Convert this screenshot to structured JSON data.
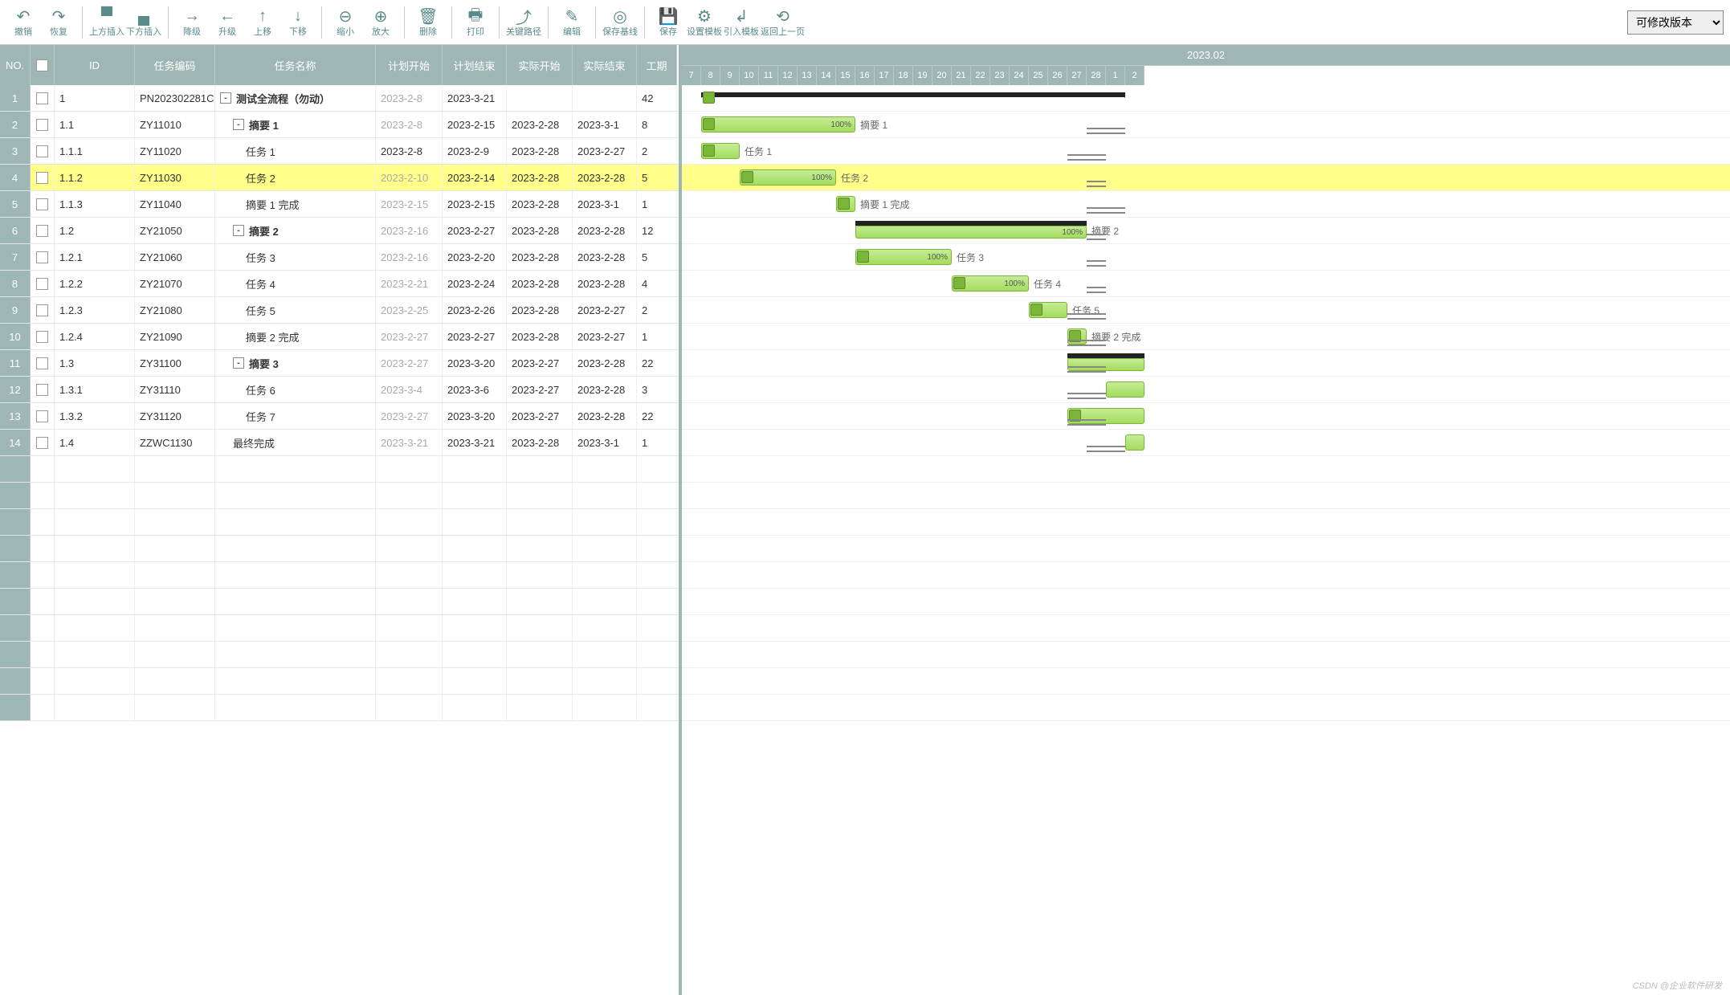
{
  "toolbar": {
    "undo": "撤销",
    "redo": "恢复",
    "insertAbove": "上方插入",
    "insertBelow": "下方插入",
    "demote": "降级",
    "promote": "升级",
    "moveUp": "上移",
    "moveDown": "下移",
    "zoomOut": "缩小",
    "zoomIn": "放大",
    "delete": "删除",
    "print": "打印",
    "criticalPath": "关键路径",
    "edit": "编辑",
    "saveBaseline": "保存基线",
    "save": "保存",
    "setTemplate": "设置模板",
    "importTemplate": "引入模板",
    "back": "返回上一页"
  },
  "versionSelect": {
    "value": "可修改版本"
  },
  "columns": {
    "no": "NO.",
    "id": "ID",
    "code": "任务编码",
    "name": "任务名称",
    "pstart": "计划开始",
    "pend": "计划结束",
    "astart": "实际开始",
    "aend": "实际结束",
    "dur": "工期"
  },
  "timeline": {
    "month": "2023.02",
    "days": [
      "7",
      "8",
      "9",
      "10",
      "11",
      "12",
      "13",
      "14",
      "15",
      "16",
      "17",
      "18",
      "19",
      "20",
      "21",
      "22",
      "23",
      "24",
      "25",
      "26",
      "27",
      "28",
      "1",
      "2"
    ]
  },
  "rows": [
    {
      "no": "1",
      "id": "1",
      "code": "PN202302281C",
      "name": "测试全流程（勿动）",
      "pstart": "2023-2-8",
      "pend": "2023-3-21",
      "astart": "",
      "aend": "",
      "dur": "42",
      "indent": 0,
      "exp": "-",
      "bold": true,
      "grayPlan": true,
      "type": "summary",
      "barStart": 1,
      "barLen": 22,
      "label": "",
      "markerAt": 1
    },
    {
      "no": "2",
      "id": "1.1",
      "code": "ZY11010",
      "name": "摘要 1",
      "pstart": "2023-2-8",
      "pend": "2023-2-15",
      "astart": "2023-2-28",
      "aend": "2023-3-1",
      "dur": "8",
      "indent": 1,
      "exp": "-",
      "bold": true,
      "grayPlan": true,
      "type": "task",
      "barStart": 1,
      "barLen": 8,
      "pct": "100%",
      "label": "摘要 1",
      "markerAt": 1,
      "baseline": true,
      "blStart": 21,
      "blLen": 2
    },
    {
      "no": "3",
      "id": "1.1.1",
      "code": "ZY11020",
      "name": "任务 1",
      "pstart": "2023-2-8",
      "pend": "2023-2-9",
      "astart": "2023-2-28",
      "aend": "2023-2-27",
      "dur": "2",
      "indent": 2,
      "type": "task",
      "barStart": 1,
      "barLen": 2,
      "label": "任务 1",
      "markerAt": 1,
      "baseline": true,
      "blStart": 20,
      "blLen": 2
    },
    {
      "no": "4",
      "id": "1.1.2",
      "code": "ZY11030",
      "name": "任务 2",
      "pstart": "2023-2-10",
      "pend": "2023-2-14",
      "astart": "2023-2-28",
      "aend": "2023-2-28",
      "dur": "5",
      "indent": 2,
      "grayPlan": true,
      "sel": true,
      "type": "task",
      "barStart": 3,
      "barLen": 5,
      "pct": "100%",
      "label": "任务 2",
      "markerAt": 3,
      "baseline": true,
      "blStart": 21,
      "blLen": 1
    },
    {
      "no": "5",
      "id": "1.1.3",
      "code": "ZY11040",
      "name": "摘要 1 完成",
      "pstart": "2023-2-15",
      "pend": "2023-2-15",
      "astart": "2023-2-28",
      "aend": "2023-3-1",
      "dur": "1",
      "indent": 2,
      "grayPlan": true,
      "type": "task",
      "barStart": 8,
      "barLen": 1,
      "label": "摘要 1 完成",
      "markerAt": 8,
      "baseline": true,
      "blStart": 21,
      "blLen": 2
    },
    {
      "no": "6",
      "id": "1.2",
      "code": "ZY21050",
      "name": "摘要 2",
      "pstart": "2023-2-16",
      "pend": "2023-2-27",
      "astart": "2023-2-28",
      "aend": "2023-2-28",
      "dur": "12",
      "indent": 1,
      "exp": "-",
      "bold": true,
      "grayPlan": true,
      "type": "summary-task",
      "barStart": 9,
      "barLen": 12,
      "pct": "100%",
      "label": "摘要 2",
      "baseline": true,
      "blStart": 21,
      "blLen": 1
    },
    {
      "no": "7",
      "id": "1.2.1",
      "code": "ZY21060",
      "name": "任务 3",
      "pstart": "2023-2-16",
      "pend": "2023-2-20",
      "astart": "2023-2-28",
      "aend": "2023-2-28",
      "dur": "5",
      "indent": 2,
      "grayPlan": true,
      "type": "task",
      "barStart": 9,
      "barLen": 5,
      "pct": "100%",
      "label": "任务 3",
      "markerAt": 9,
      "baseline": true,
      "blStart": 21,
      "blLen": 1
    },
    {
      "no": "8",
      "id": "1.2.2",
      "code": "ZY21070",
      "name": "任务 4",
      "pstart": "2023-2-21",
      "pend": "2023-2-24",
      "astart": "2023-2-28",
      "aend": "2023-2-28",
      "dur": "4",
      "indent": 2,
      "grayPlan": true,
      "type": "task",
      "barStart": 14,
      "barLen": 4,
      "pct": "100%",
      "label": "任务 4",
      "markerAt": 14,
      "baseline": true,
      "blStart": 21,
      "blLen": 1
    },
    {
      "no": "9",
      "id": "1.2.3",
      "code": "ZY21080",
      "name": "任务 5",
      "pstart": "2023-2-25",
      "pend": "2023-2-26",
      "astart": "2023-2-28",
      "aend": "2023-2-27",
      "dur": "2",
      "indent": 2,
      "grayPlan": true,
      "type": "task",
      "barStart": 18,
      "barLen": 2,
      "label": "任务 5",
      "markerAt": 18,
      "baseline": true,
      "blStart": 20,
      "blLen": 2
    },
    {
      "no": "10",
      "id": "1.2.4",
      "code": "ZY21090",
      "name": "摘要 2 完成",
      "pstart": "2023-2-27",
      "pend": "2023-2-27",
      "astart": "2023-2-28",
      "aend": "2023-2-27",
      "dur": "1",
      "indent": 2,
      "grayPlan": true,
      "type": "task",
      "barStart": 20,
      "barLen": 1,
      "label": "摘要 2 完成",
      "markerAt": 20,
      "baseline": true,
      "blStart": 20,
      "blLen": 2
    },
    {
      "no": "11",
      "id": "1.3",
      "code": "ZY31100",
      "name": "摘要 3",
      "pstart": "2023-2-27",
      "pend": "2023-3-20",
      "astart": "2023-2-27",
      "aend": "2023-2-28",
      "dur": "22",
      "indent": 1,
      "exp": "-",
      "bold": true,
      "grayPlan": true,
      "type": "summary-task",
      "barStart": 20,
      "barLen": 4,
      "label": "",
      "baseline": true,
      "blStart": 20,
      "blLen": 2
    },
    {
      "no": "12",
      "id": "1.3.1",
      "code": "ZY31110",
      "name": "任务 6",
      "pstart": "2023-3-4",
      "pend": "2023-3-6",
      "astart": "2023-2-27",
      "aend": "2023-2-28",
      "dur": "3",
      "indent": 2,
      "grayPlan": true,
      "type": "task",
      "barStart": 22,
      "barLen": 2,
      "label": "",
      "baseline": true,
      "blStart": 20,
      "blLen": 2
    },
    {
      "no": "13",
      "id": "1.3.2",
      "code": "ZY31120",
      "name": "任务 7",
      "pstart": "2023-2-27",
      "pend": "2023-3-20",
      "astart": "2023-2-27",
      "aend": "2023-2-28",
      "dur": "22",
      "indent": 2,
      "grayPlan": true,
      "type": "task",
      "barStart": 20,
      "barLen": 4,
      "label": "",
      "markerAt": 20,
      "baseline": true,
      "blStart": 20,
      "blLen": 2
    },
    {
      "no": "14",
      "id": "1.4",
      "code": "ZZWC1130",
      "name": "最终完成",
      "pstart": "2023-3-21",
      "pend": "2023-3-21",
      "astart": "2023-2-28",
      "aend": "2023-3-1",
      "dur": "1",
      "indent": 1,
      "grayPlan": true,
      "type": "task",
      "barStart": 23,
      "barLen": 1,
      "label": "",
      "baseline": true,
      "blStart": 21,
      "blLen": 2
    }
  ],
  "watermark": "CSDN @企业软件研发"
}
